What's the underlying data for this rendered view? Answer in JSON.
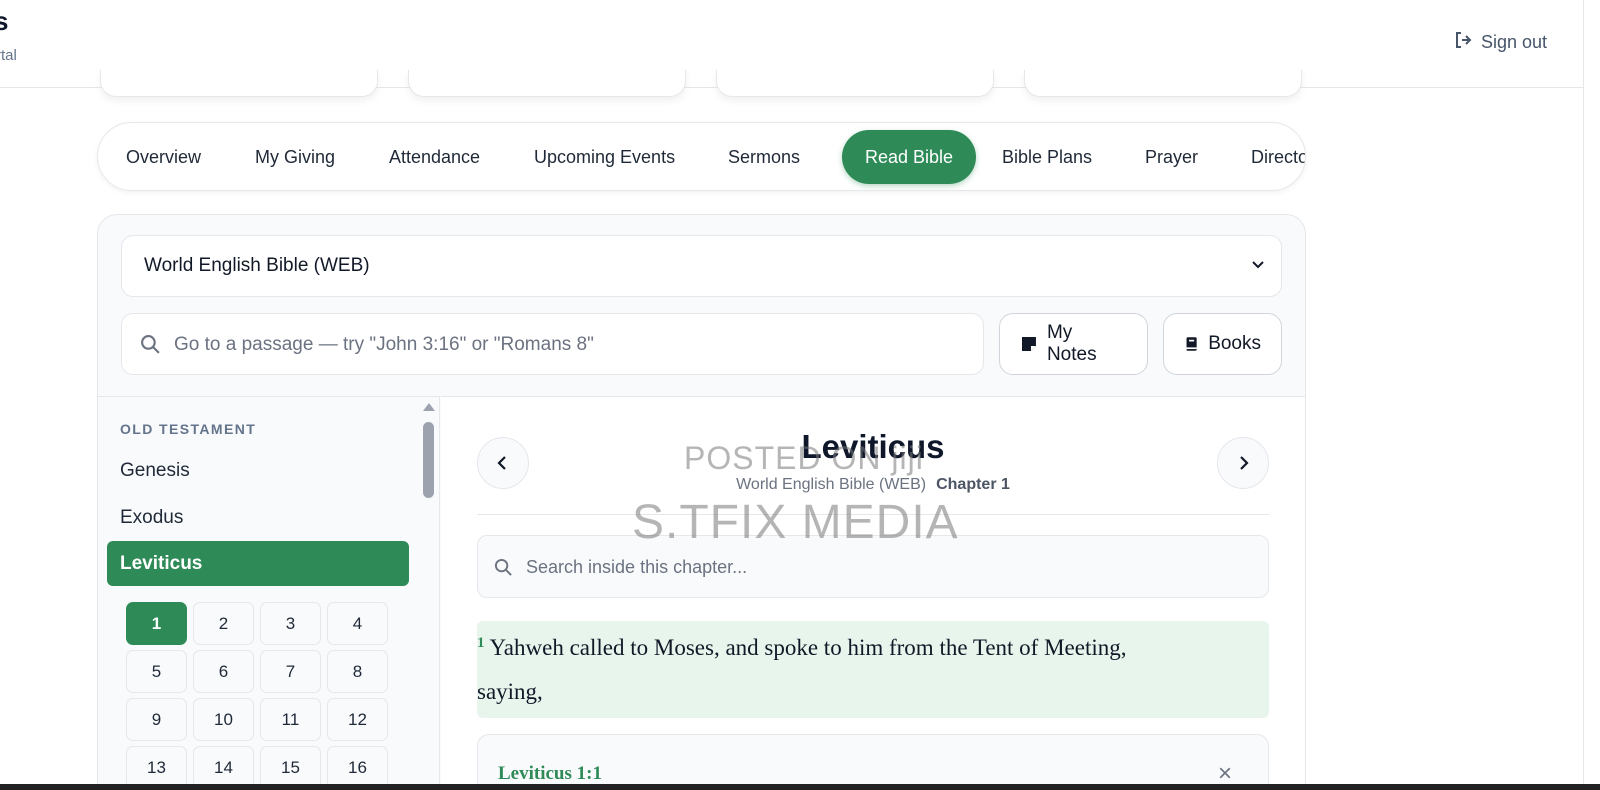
{
  "header": {
    "brand_title": "s",
    "brand_subtitle": "rtal",
    "sign_out_label": "Sign out"
  },
  "tabs": [
    {
      "label": "Overview"
    },
    {
      "label": "My Giving"
    },
    {
      "label": "Attendance"
    },
    {
      "label": "Upcoming Events"
    },
    {
      "label": "Sermons"
    },
    {
      "label": "Read Bible",
      "active": true
    },
    {
      "label": "Bible Plans"
    },
    {
      "label": "Prayer"
    },
    {
      "label": "Directo"
    }
  ],
  "bible": {
    "version_selected": "World English Bible (WEB)",
    "passage_placeholder": "Go to a passage — try \"John 3:16\" or \"Romans 8\"",
    "my_notes_label": "My Notes",
    "books_label": "Books"
  },
  "sidebar": {
    "section_label": "OLD TESTAMENT",
    "books": [
      "Genesis",
      "Exodus",
      "Leviticus"
    ],
    "active_book": "Leviticus",
    "chapters": [
      "1",
      "2",
      "3",
      "4",
      "5",
      "6",
      "7",
      "8",
      "9",
      "10",
      "11",
      "12",
      "13",
      "14",
      "15",
      "16"
    ],
    "active_chapter": "1"
  },
  "reader": {
    "book_title": "Leviticus",
    "version": "World English Bible (WEB)",
    "chapter": "Chapter 1",
    "chapter_search_placeholder": "Search inside this chapter...",
    "verse_number": "1",
    "verse_text_line1": "Yahweh called to Moses, and spoke to him from the Tent of Meeting,",
    "verse_text_line2": "saying,",
    "note_reference": "Leviticus 1:1",
    "note_close": "×"
  },
  "watermark": {
    "line1": "POSTED ON jiji",
    "line2": "S.TFIX MEDIA"
  },
  "colors": {
    "accent": "#2e8b57",
    "verse_highlight": "#e8f5ec"
  }
}
